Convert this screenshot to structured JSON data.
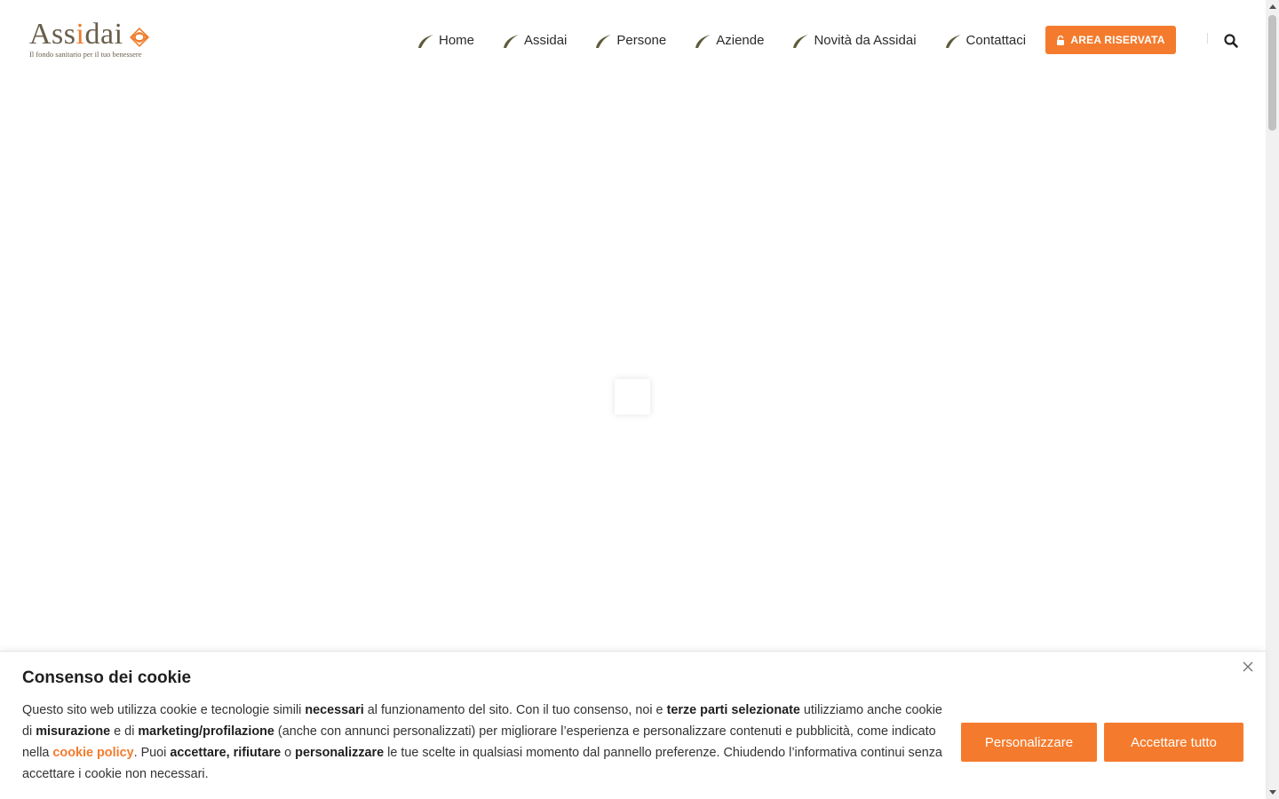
{
  "logo": {
    "name_part1": "Ass",
    "name_accent": "i",
    "name_part2": "dai",
    "tagline": "Il fondo sanitario per il tuo benessere"
  },
  "nav": {
    "items": [
      {
        "label": "Home"
      },
      {
        "label": "Assidai"
      },
      {
        "label": "Persone"
      },
      {
        "label": "Aziende"
      },
      {
        "label": "Novità da Assidai"
      },
      {
        "label": "Contattaci"
      }
    ],
    "area_button": "AREA RISERVATA",
    "icons": {
      "leaf": "leaf-icon",
      "lock": "lock-icon",
      "search": "search-icon"
    }
  },
  "cookie": {
    "title": "Consenso dei cookie",
    "t1": "Questo sito web utilizza cookie e tecnologie simili ",
    "b1": "necessari",
    "t2": " al funzionamento del sito. Con il tuo consenso, noi e ",
    "b2": "terze parti selezionate",
    "t3": " utilizziamo anche cookie di ",
    "b3": "misurazione",
    "t4": " e di ",
    "b4": "marketing/profilazione",
    "t5": " (anche con annunci personalizzati) per migliorare l’esperienza e personalizzare contenuti e pubblicità, come indicato nella ",
    "link": "cookie policy",
    "t6": ". Puoi ",
    "b5": "accettare, rifiutare",
    "t7": " o ",
    "b6": "personalizzare",
    "t8": " le tue scelte in qualsiasi momento dal pannello preferenze. Chiudendo l’informativa continui senza accettare i cookie non necessari.",
    "customize_button": "Personalizzare",
    "accept_button": "Accettare tutto"
  },
  "colors": {
    "accent": "#f47b2d",
    "logo_brown": "#6a5f4c",
    "leaf_green": "#5e5a3a"
  }
}
